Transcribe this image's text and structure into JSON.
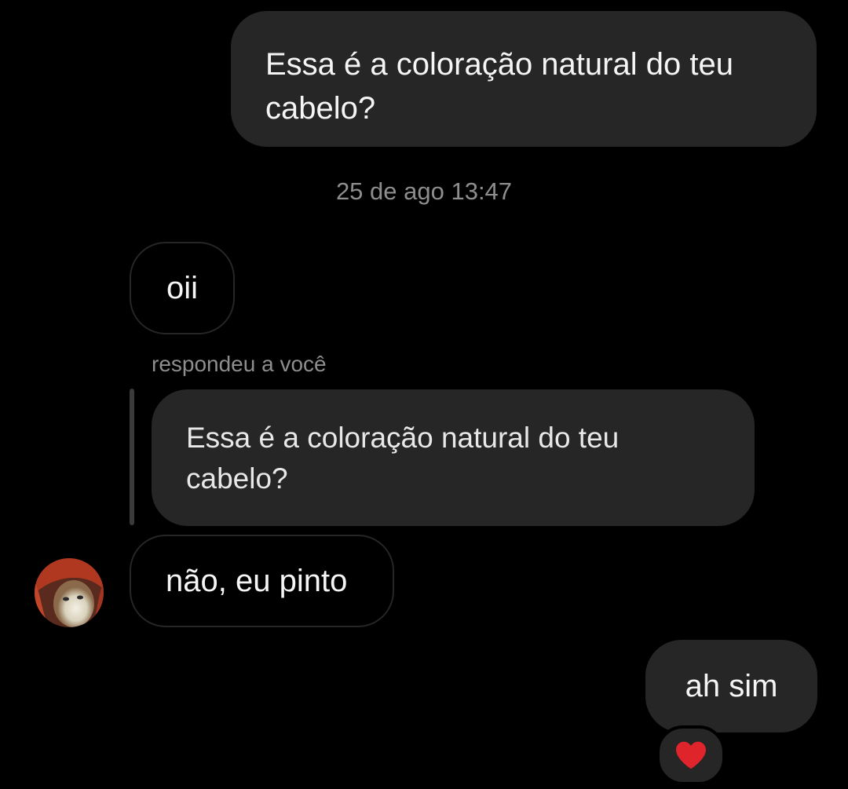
{
  "messages": {
    "outgoing_1": "Essa é a coloração natural do teu cabelo?",
    "timestamp": "25 de ago 13:47",
    "incoming_1": "oii",
    "reply_label": "respondeu a você",
    "quoted": "Essa é a coloração natural do teu cabelo?",
    "incoming_2": "não, eu pinto",
    "outgoing_2": "ah sim"
  },
  "reaction": {
    "icon": "heart-icon",
    "color": "#e0242b"
  },
  "colors": {
    "background": "#000000",
    "bubble": "#262626",
    "meta_text": "#8e8e8e"
  }
}
